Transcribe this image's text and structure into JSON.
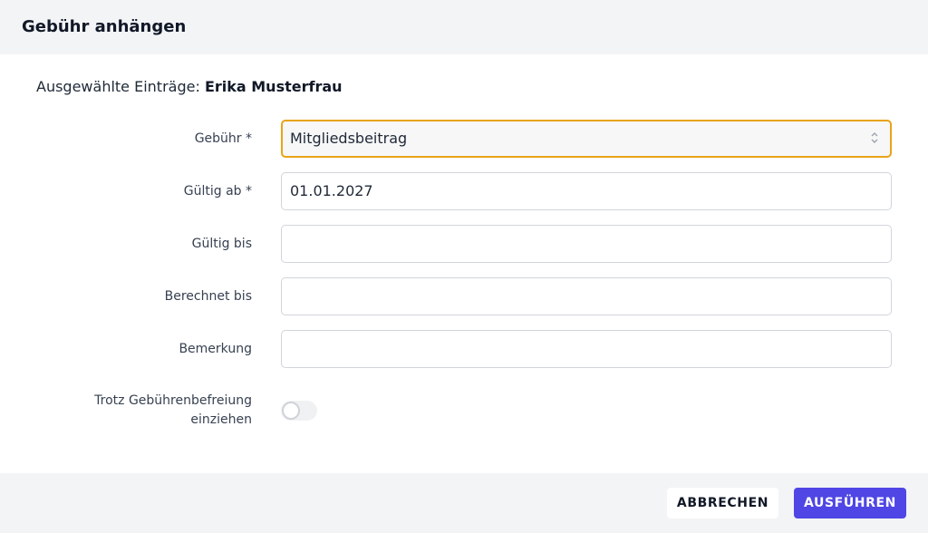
{
  "dialog": {
    "title": "Gebühr anhängen"
  },
  "selection": {
    "label": "Ausgewählte Einträge:",
    "name": "Erika Musterfrau"
  },
  "form": {
    "fee": {
      "label": "Gebühr *",
      "value": "Mitgliedsbeitrag"
    },
    "valid_from": {
      "label": "Gültig ab *",
      "value": "01.01.2027"
    },
    "valid_to": {
      "label": "Gültig bis",
      "value": ""
    },
    "charged_to": {
      "label": "Berechnet bis",
      "value": ""
    },
    "remark": {
      "label": "Bemerkung",
      "value": ""
    },
    "exemption": {
      "label_line1": "Trotz Gebührenbefreiung",
      "label_line2": "einziehen",
      "enabled": false
    }
  },
  "footer": {
    "cancel_label": "ABBRECHEN",
    "run_label": "AUSFÜHREN"
  },
  "colors": {
    "accent": "#4f46e5",
    "focus_border": "#e8a317",
    "header_bg": "#f3f4f6"
  }
}
